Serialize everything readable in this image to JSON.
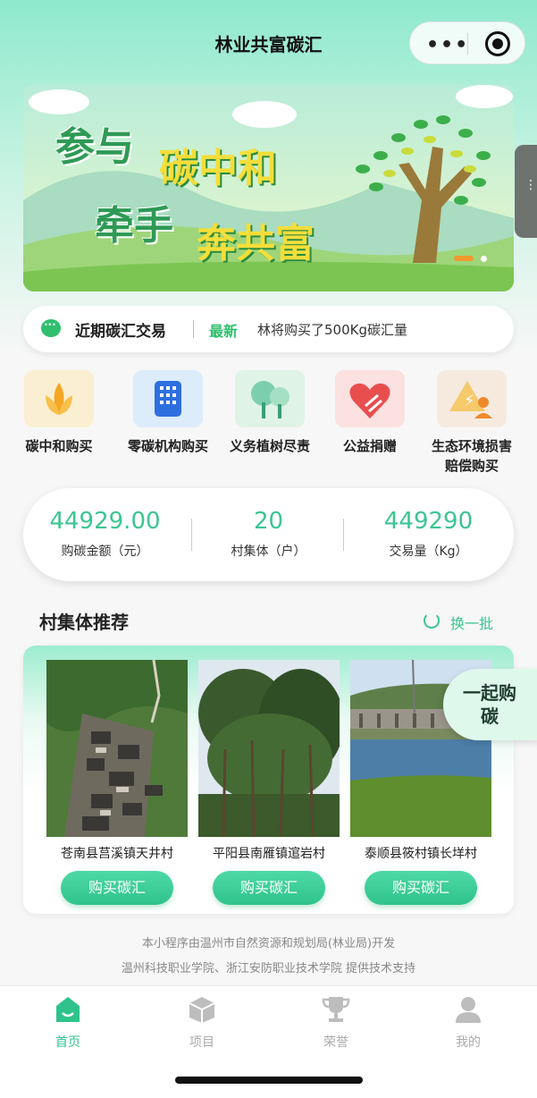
{
  "header": {
    "title": "林业共富碳汇",
    "more_icon": "more-dots-icon",
    "close_icon": "target-icon"
  },
  "banner": {
    "line1a": "参与",
    "line1b": "碳中和",
    "line2a": "牵手",
    "line2b": "奔共富"
  },
  "ticker": {
    "title": "近期碳汇交易",
    "badge": "最新",
    "message": "林将购买了500Kg碳汇量"
  },
  "categories": [
    {
      "label": "碳中和购买",
      "icon": "lotus-icon"
    },
    {
      "label": "零碳机构购买",
      "icon": "building-icon"
    },
    {
      "label": "义务植树尽责",
      "icon": "trees-icon"
    },
    {
      "label": "公益捐赠",
      "icon": "heart-hand-icon"
    },
    {
      "label": "生态环境损害赔偿购买",
      "icon": "warning-person-icon"
    }
  ],
  "stats": [
    {
      "value": "44929.00",
      "caption": "购碳金额（元）"
    },
    {
      "value": "20",
      "caption": "村集体（户）"
    },
    {
      "value": "449290",
      "caption": "交易量（Kg）"
    }
  ],
  "section": {
    "title": "村集体推荐",
    "refresh": "换一批"
  },
  "villages": [
    {
      "name": "苍南县莒溪镇天井村",
      "button": "购买碳汇"
    },
    {
      "name": "平阳县南雁镇逭岩村",
      "button": "购买碳汇"
    },
    {
      "name": "泰顺县筱村镇长垟村",
      "button": "购买碳汇"
    }
  ],
  "together": "一起购碳",
  "footer": {
    "line1": "本小程序由温州市自然资源和规划局(林业局)开发",
    "line2": "温州科技职业学院、浙江安防职业技术学院 提供技术支持"
  },
  "tabs": [
    {
      "label": "首页",
      "active": true
    },
    {
      "label": "项目",
      "active": false
    },
    {
      "label": "荣誉",
      "active": false
    },
    {
      "label": "我的",
      "active": false
    }
  ],
  "colors": {
    "accent": "#2fc38b",
    "stat": "#3cc590"
  }
}
